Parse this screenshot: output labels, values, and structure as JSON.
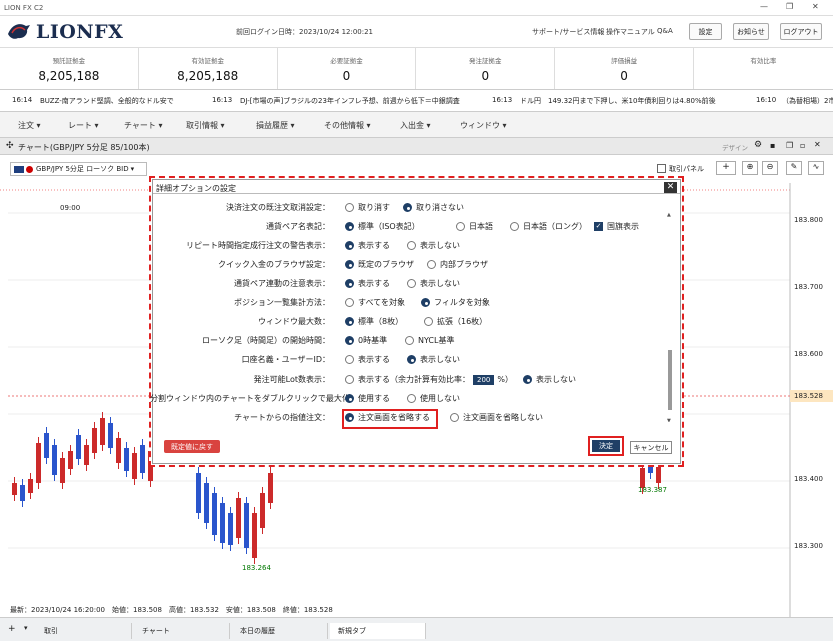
{
  "titlebar": {
    "title": "LION FX C2",
    "min": "—",
    "max": "❐",
    "close": "✕"
  },
  "header": {
    "brand": "LIONFX",
    "login": "前回ログイン日時：2023/10/24 12:00:21",
    "links": [
      "サポート/サービス情報",
      "操作マニュアル",
      "Q&A"
    ],
    "buttons": [
      "設定",
      "お知らせ",
      "ログアウト"
    ]
  },
  "account": [
    {
      "label": "預託証拠金",
      "value": "8,205,188"
    },
    {
      "label": "有効証拠金",
      "value": "8,205,188"
    },
    {
      "label": "必要証拠金",
      "value": "0"
    },
    {
      "label": "発注証拠金",
      "value": "0"
    },
    {
      "label": "評価損益",
      "value": "0"
    },
    {
      "label": "有効比率",
      "value": ""
    }
  ],
  "ticker": [
    "16:14",
    "BUZZ-南アランド堅調、全般的なドル安で",
    "16:13",
    "DJ-[市場の声]ブラジルの23年インフレ予想、前週から低下＝中銀調査",
    "16:13",
    "ドル円　149.32円まで下押し、米10年債利回りは4.80%前後",
    "16:10",
    "（為替相場）2市"
  ],
  "menu": [
    "注文",
    "レート",
    "チャート",
    "取引情報",
    "損益履歴",
    "その他情報",
    "入出金",
    "ウィンドウ"
  ],
  "chart": {
    "bar_title": "チャート(GBP/JPY 5分足 85/100本)",
    "design": "デザイン",
    "symbol": "GBP/JPY 5分足 ローソク BID",
    "trade_panel": "取引パネル",
    "time_label": "09:00",
    "price_ticks": [
      "183.800",
      "183.700",
      "183.600",
      "183.528",
      "183.400",
      "183.300"
    ],
    "low_label": "183.264",
    "mark_label": "183.387",
    "footer": "最新：2023/10/24 16:20:00　始値：183.508　高値：183.532　安値：183.508　終値：183.528"
  },
  "dialog": {
    "title": "詳細オプションの設定",
    "close": "✕",
    "rows": [
      {
        "label": "決済注文の既注文取消設定：",
        "options": [
          "取り消す",
          "取り消さない"
        ],
        "selected": 1
      },
      {
        "label": "通貨ペア名表記：",
        "options": [
          "標準（ISO表記）",
          "日本語",
          "日本語（ロング）"
        ],
        "selected": 0,
        "checkbox": "国旗表示"
      },
      {
        "label": "リピート時間指定成行注文の警告表示：",
        "options": [
          "表示する",
          "表示しない"
        ],
        "selected": 0
      },
      {
        "label": "クイック入金のブラウザ設定：",
        "options": [
          "既定のブラウザ",
          "内部ブラウザ"
        ],
        "selected": 0
      },
      {
        "label": "通貨ペア連動の注意表示：",
        "options": [
          "表示する",
          "表示しない"
        ],
        "selected": 0
      },
      {
        "label": "ポジション一覧集計方法：",
        "options": [
          "すべてを対象",
          "フィルタを対象"
        ],
        "selected": 1
      },
      {
        "label": "ウィンドウ最大数：",
        "options": [
          "標準（8枚）",
          "拡張（16枚）"
        ],
        "selected": 0
      },
      {
        "label": "ローソク足（時間足）の開始時間：",
        "options": [
          "0時基準",
          "NYCL基準"
        ],
        "selected": 0
      },
      {
        "label": "口座名義・ユーザーID：",
        "options": [
          "表示する",
          "表示しない"
        ],
        "selected": 1
      },
      {
        "label": "発注可能Lot数表示：",
        "options": [
          "表示する（余力計算有効比率：",
          "%）",
          "表示しない"
        ],
        "ratio": "200",
        "selected": 2
      },
      {
        "label": "分割ウィンドウ内のチャートをダブルクリックで最大化：",
        "options": [
          "使用する",
          "使用しない"
        ],
        "selected": 0
      },
      {
        "label": "チャートからの指値注文：",
        "options": [
          "注文画面を省略する",
          "注文画面を省略しない"
        ],
        "selected": 0
      }
    ],
    "reset": "既定値に戻す",
    "ok": "決定",
    "cancel": "キャンセル"
  },
  "bottom_tabs": [
    "取引",
    "チャート",
    "本日の履歴",
    "新規タブ"
  ],
  "colors": {
    "accent": "#1f3f66",
    "highlight": "#e02020",
    "up": "#cc2a2a",
    "down": "#2a55cc"
  }
}
